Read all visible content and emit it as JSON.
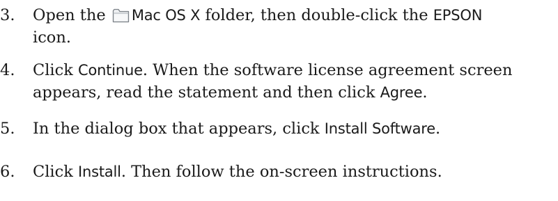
{
  "steps": [
    {
      "number": "3.",
      "lines": [
        {
          "segments": [
            {
              "text": "Open the ",
              "style": "serif"
            },
            {
              "icon": "folder-icon"
            },
            {
              "text": "Mac OS X",
              "style": "ui"
            },
            {
              "text": " folder, then double-click the ",
              "style": "serif"
            },
            {
              "text": "EPSON",
              "style": "ui"
            }
          ]
        },
        {
          "segments": [
            {
              "text": "icon.",
              "style": "serif"
            }
          ]
        }
      ]
    },
    {
      "number": "4.",
      "lines": [
        {
          "segments": [
            {
              "text": "Click ",
              "style": "serif"
            },
            {
              "text": "Continue",
              "style": "ui"
            },
            {
              "text": ". When the software license agreement screen",
              "style": "serif"
            }
          ]
        },
        {
          "segments": [
            {
              "text": "appears, read the statement and then click ",
              "style": "serif"
            },
            {
              "text": "Agree",
              "style": "ui"
            },
            {
              "text": ".",
              "style": "serif"
            }
          ]
        }
      ]
    },
    {
      "number": "5.",
      "lines": [
        {
          "segments": [
            {
              "text": "In the dialog box that appears, click ",
              "style": "serif"
            },
            {
              "text": "Install Software",
              "style": "ui"
            },
            {
              "text": ".",
              "style": "serif"
            }
          ]
        }
      ]
    },
    {
      "number": "6.",
      "lines": [
        {
          "segments": [
            {
              "text": "Click ",
              "style": "serif"
            },
            {
              "text": "Install",
              "style": "ui"
            },
            {
              "text": ". Then follow the on-screen instructions.",
              "style": "serif"
            }
          ]
        }
      ]
    }
  ],
  "colors": {
    "text": "#1a1a1a",
    "folder_fill": "#eef0f2",
    "folder_stroke": "#7b8187"
  }
}
